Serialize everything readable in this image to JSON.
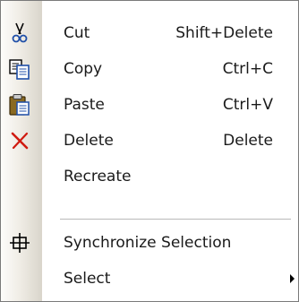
{
  "menu": {
    "items": [
      {
        "label": "Cut",
        "shortcut": "Shift+Delete",
        "icon": "scissors-icon"
      },
      {
        "label": "Copy",
        "shortcut": "Ctrl+C",
        "icon": "copy-icon"
      },
      {
        "label": "Paste",
        "shortcut": "Ctrl+V",
        "icon": "paste-icon"
      },
      {
        "label": "Delete",
        "shortcut": "Delete",
        "icon": "delete-x-icon"
      },
      {
        "label": "Recreate",
        "shortcut": "",
        "icon": ""
      },
      {
        "label": "Synchronize Selection",
        "shortcut": "",
        "icon": "synchronize-icon"
      },
      {
        "label": "Select",
        "shortcut": "",
        "icon": "",
        "has_submenu": true
      }
    ]
  },
  "colors": {
    "delete_icon": "#d01a10",
    "separator": "#b9b9b9",
    "border": "#7a7a7a"
  }
}
